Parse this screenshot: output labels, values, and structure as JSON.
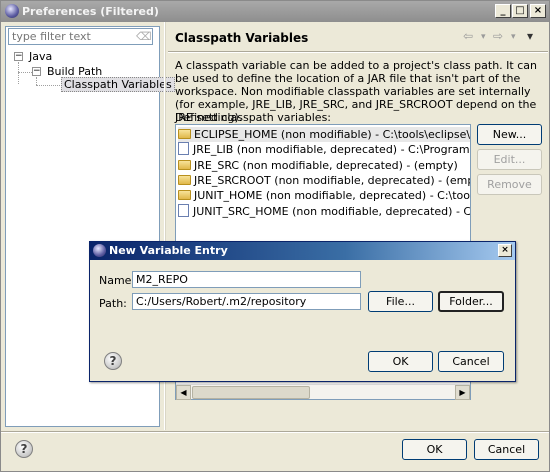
{
  "window": {
    "title": "Preferences (Filtered)",
    "controls": {
      "minimize": "_",
      "maximize": "□",
      "close": "×"
    }
  },
  "sidebar": {
    "filter_placeholder": "type filter text",
    "tree": [
      {
        "label": "Java",
        "expanded": true
      },
      {
        "label": "Build Path",
        "expanded": true
      },
      {
        "label": "Classpath Variables",
        "selected": true
      }
    ]
  },
  "page": {
    "title": "Classpath Variables",
    "nav": {
      "back": "⇦",
      "forward": "⇨",
      "menu": "▾"
    },
    "description": "A classpath variable can be added to a project's class path. It can be used to define the location of a JAR file that isn't part of the workspace. Non modifiable classpath variables are set internally (for example, JRE_LIB, JRE_SRC, and JRE_SRCROOT depend on the JRE setting).",
    "list_label": "Defined classpath variables:",
    "variables": [
      {
        "text": "ECLIPSE_HOME (non modifiable) - C:\\tools\\eclipse\\eclipseIndigo",
        "icon": "folder-icon",
        "selected": true
      },
      {
        "text": "JRE_LIB (non modifiable, deprecated) - C:\\Program Files\\Java\\jr",
        "icon": "jar-icon"
      },
      {
        "text": "JRE_SRC (non modifiable, deprecated) - (empty)",
        "icon": "folder-icon"
      },
      {
        "text": "JRE_SRCROOT (non modifiable, deprecated) - (empty)",
        "icon": "folder-icon"
      },
      {
        "text": "JUNIT_HOME (non modifiable, deprecated) - C:\\tools\\eclipse\\ecli",
        "icon": "folder-icon"
      },
      {
        "text": "JUNIT_SRC_HOME (non modifiable, deprecated) - C:\\tools\\eclips",
        "icon": "jar-icon"
      }
    ],
    "buttons": {
      "new": "New...",
      "edit": "Edit...",
      "remove": "Remove"
    }
  },
  "footer": {
    "ok": "OK",
    "cancel": "Cancel"
  },
  "dialog": {
    "title": "New Variable Entry",
    "close": "×",
    "name_label": "Name:",
    "name_value": "M2_REPO",
    "path_label": "Path:",
    "path_value": "C:/Users/Robert/.m2/repository",
    "file_button": "File...",
    "folder_button": "Folder...",
    "ok": "OK",
    "cancel": "Cancel"
  }
}
